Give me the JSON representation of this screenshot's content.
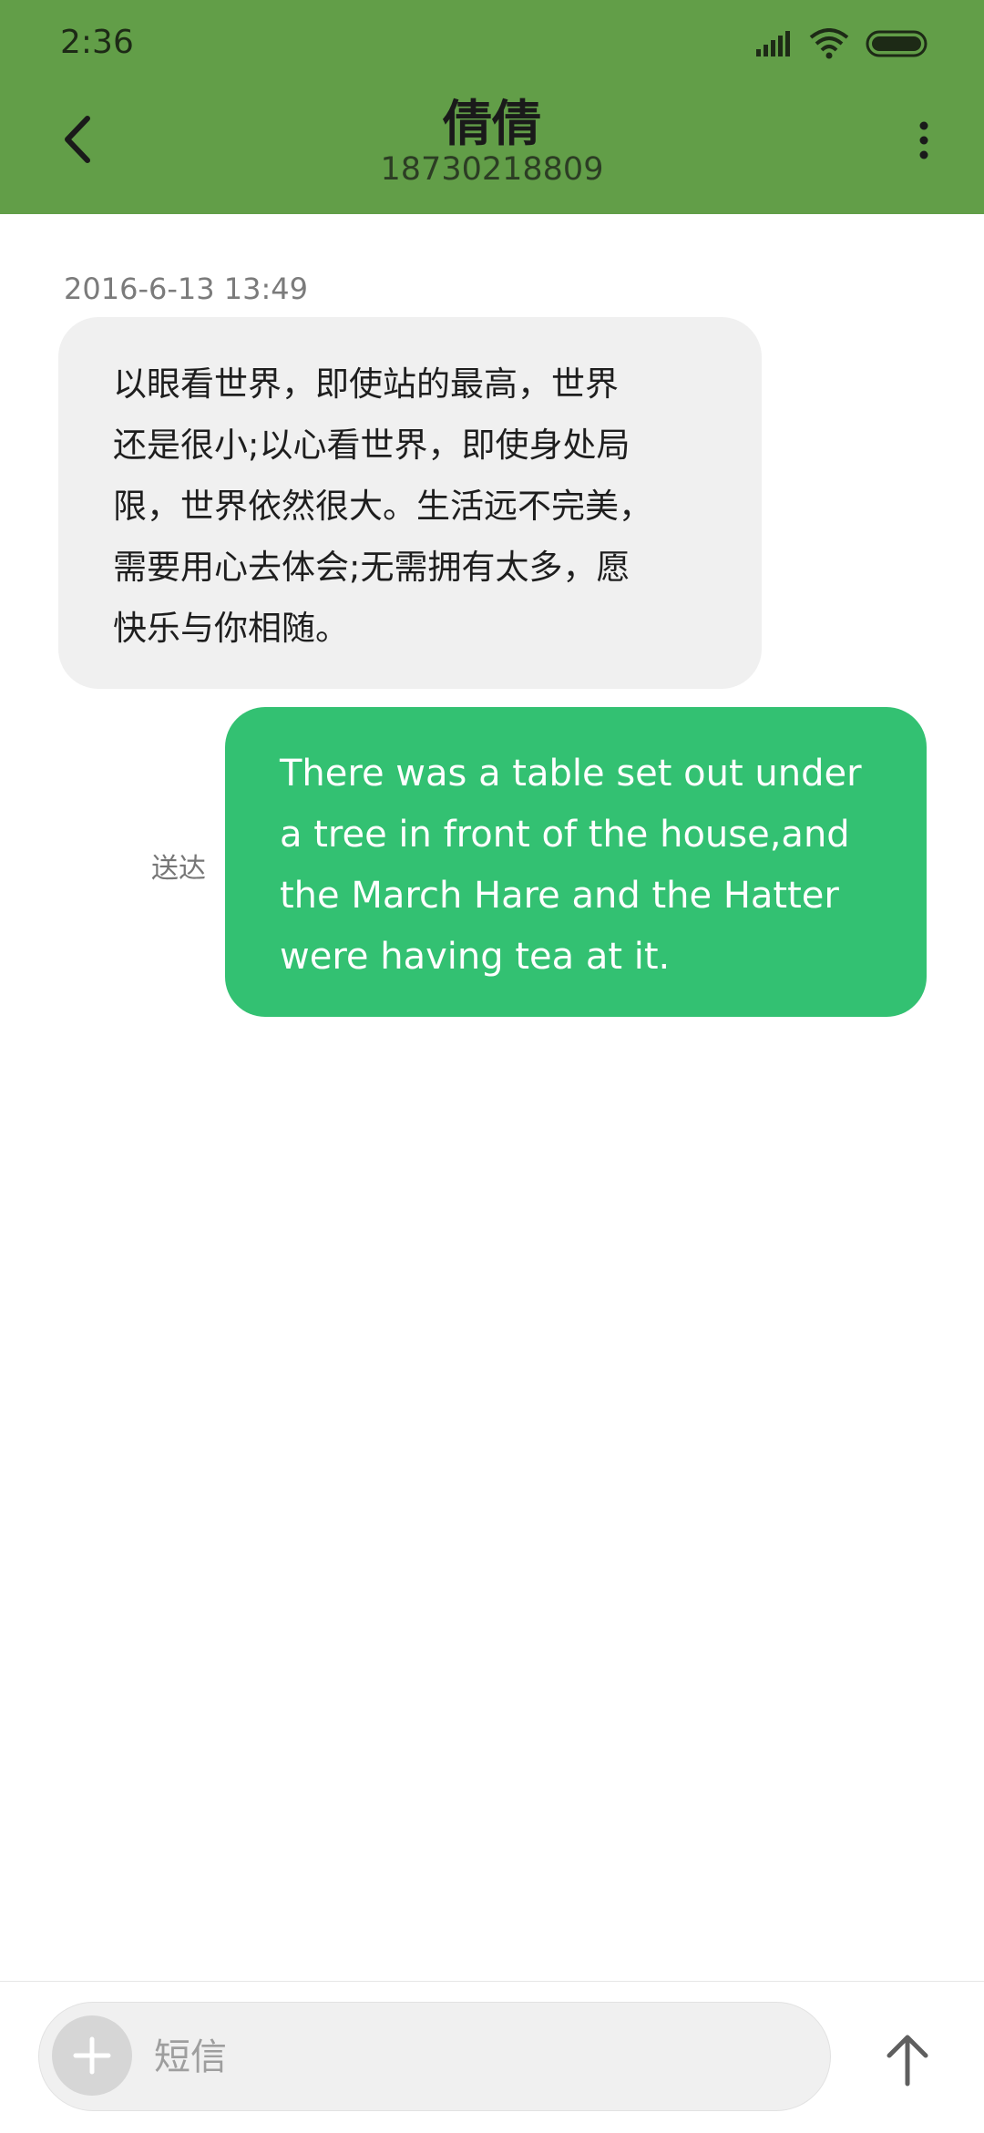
{
  "status_bar": {
    "time": "2:36",
    "icons": [
      "signal-icon",
      "wifi-icon",
      "battery-icon"
    ]
  },
  "header": {
    "back_icon": "back-arrow-icon",
    "title": "倩倩",
    "subtitle": "18730218809",
    "menu_icon": "more-vertical-icon"
  },
  "messages": {
    "timestamp": "2016-6-13 13:49",
    "incoming": {
      "lines": [
        "以眼看世界，即使站的最高，世界",
        "还是很小;以心看世界，即使身处局",
        "限，世界依然很大。生活远不完美，",
        "需要用心去体会;无需拥有太多，愿",
        "快乐与你相随。"
      ]
    },
    "outgoing": {
      "status": "送达",
      "lines": [
        "There was a table set out under",
        "a tree in front of the house,and",
        "the March Hare and the Hatter",
        "were having tea at it."
      ]
    }
  },
  "composer": {
    "add_icon": "plus-icon",
    "placeholder": "短信",
    "send_icon": "send-arrow-icon"
  },
  "colors": {
    "header_bg": "#629e48",
    "incoming_bubble": "#f0f0f0",
    "outgoing_bubble": "#33c172"
  }
}
